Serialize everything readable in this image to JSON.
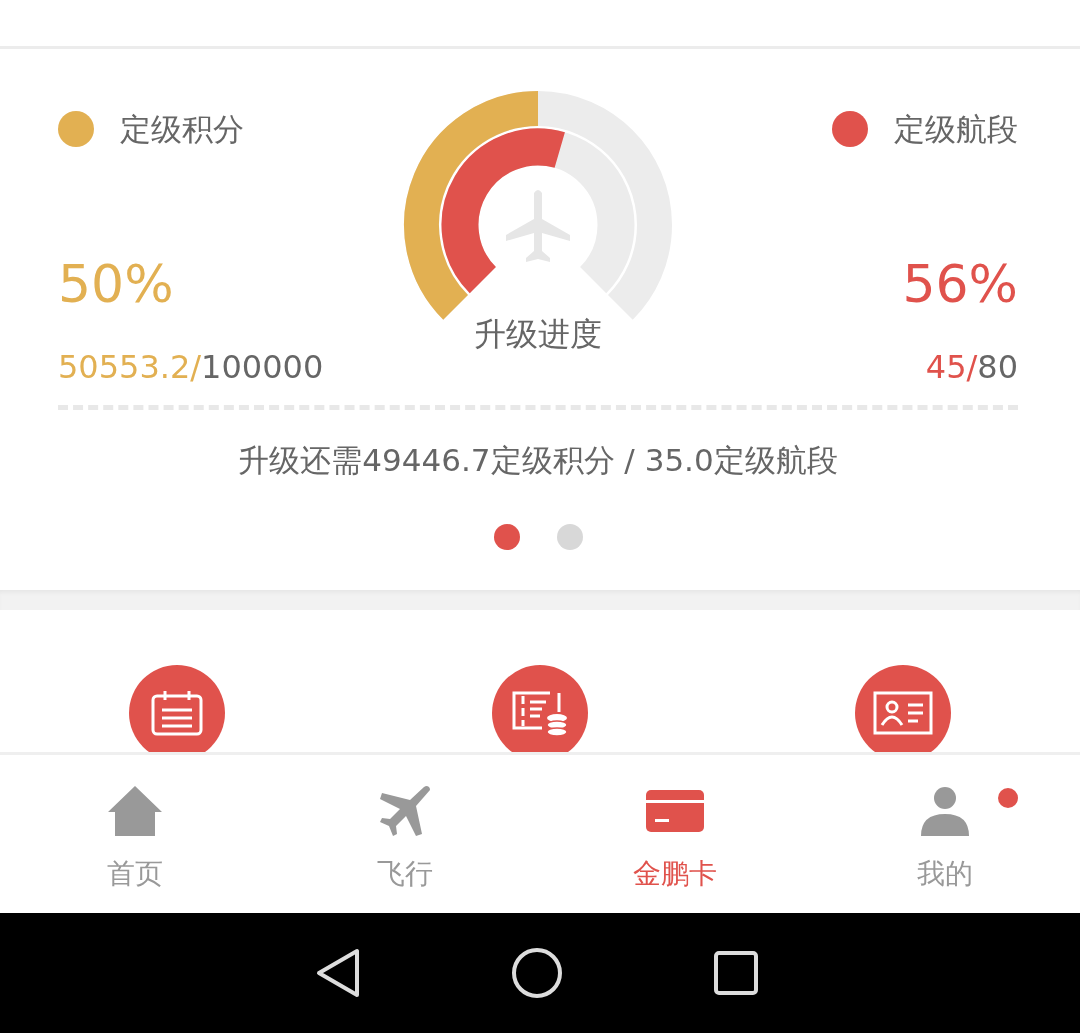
{
  "progress": {
    "metrics": [
      {
        "label": "定级积分",
        "color": "#e2b052",
        "percent": "50%",
        "earned": "50553.2/",
        "target": "100000"
      },
      {
        "label": "定级航段",
        "color": "#e0524c",
        "percent": "56%",
        "earned": "45/",
        "target": "80"
      }
    ],
    "center_label": "升级进度",
    "summary": "升级还需49446.7定级积分 / 35.0定级航段",
    "pages": [
      {
        "selected": true
      },
      {
        "selected": false
      }
    ]
  },
  "shortcuts": [
    {
      "kind": "calendar"
    },
    {
      "kind": "ticket"
    },
    {
      "kind": "card"
    }
  ],
  "tab_bar": [
    {
      "label": "首页",
      "kind": "home",
      "selected": false,
      "badge": false
    },
    {
      "label": "飞行",
      "kind": "flight",
      "selected": false,
      "badge": false
    },
    {
      "label": "金鹏卡",
      "kind": "card",
      "selected": true,
      "badge": false
    },
    {
      "label": "我的",
      "kind": "person",
      "selected": false,
      "badge": true
    }
  ]
}
